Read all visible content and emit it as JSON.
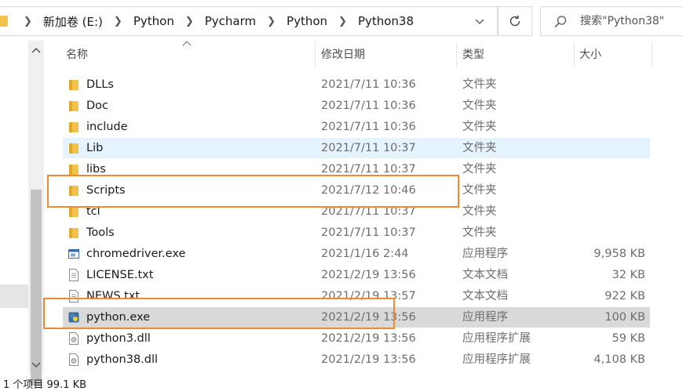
{
  "address_bar": {
    "breadcrumbs": [
      "新加卷 (E:)",
      "Python",
      "Pycharm",
      "Python",
      "Python38"
    ]
  },
  "search": {
    "placeholder": "搜索\"Python38\""
  },
  "columns": {
    "name": "名称",
    "date": "修改日期",
    "type": "类型",
    "size": "大小"
  },
  "files": [
    {
      "name": "DLLs",
      "date": "2021/7/11 10:36",
      "type": "文件夹",
      "size": "",
      "icon": "folder-icon"
    },
    {
      "name": "Doc",
      "date": "2021/7/11 10:36",
      "type": "文件夹",
      "size": "",
      "icon": "folder-icon"
    },
    {
      "name": "include",
      "date": "2021/7/11 10:36",
      "type": "文件夹",
      "size": "",
      "icon": "folder-icon"
    },
    {
      "name": "Lib",
      "date": "2021/7/11 10:37",
      "type": "文件夹",
      "size": "",
      "icon": "folder-icon"
    },
    {
      "name": "libs",
      "date": "2021/7/11 10:37",
      "type": "文件夹",
      "size": "",
      "icon": "folder-icon"
    },
    {
      "name": "Scripts",
      "date": "2021/7/12 10:46",
      "type": "文件夹",
      "size": "",
      "icon": "folder-icon"
    },
    {
      "name": "tcl",
      "date": "2021/7/11 10:37",
      "type": "文件夹",
      "size": "",
      "icon": "folder-icon"
    },
    {
      "name": "Tools",
      "date": "2021/7/11 10:37",
      "type": "文件夹",
      "size": "",
      "icon": "folder-icon"
    },
    {
      "name": "chromedriver.exe",
      "date": "2021/1/16 2:44",
      "type": "应用程序",
      "size": "9,958 KB",
      "icon": "app-icon"
    },
    {
      "name": "LICENSE.txt",
      "date": "2021/2/19 13:56",
      "type": "文本文档",
      "size": "32 KB",
      "icon": "text-file-icon"
    },
    {
      "name": "NEWS.txt",
      "date": "2021/2/19 13:57",
      "type": "文本文档",
      "size": "922 KB",
      "icon": "text-file-icon"
    },
    {
      "name": "python.exe",
      "date": "2021/2/19 13:56",
      "type": "应用程序",
      "size": "100 KB",
      "icon": "python-icon"
    },
    {
      "name": "python3.dll",
      "date": "2021/2/19 13:56",
      "type": "应用程序扩展",
      "size": "59 KB",
      "icon": "dll-icon"
    },
    {
      "name": "python38.dll",
      "date": "2021/2/19 13:56",
      "type": "应用程序扩展",
      "size": "4,108 KB",
      "icon": "dll-icon"
    }
  ],
  "status_bar": {
    "text": "1 个项目  99.1 KB"
  },
  "colors": {
    "annotation": "#ef8a33",
    "folder": "#f2c24a",
    "hover_row": "#e5f3ff",
    "selected_row": "#d9d9d9"
  }
}
